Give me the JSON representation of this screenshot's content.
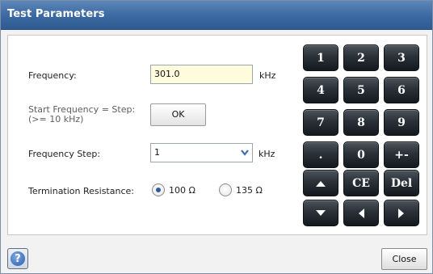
{
  "window": {
    "title": "Test Parameters"
  },
  "form": {
    "frequency_label": "Frequency:",
    "frequency_value": "301.0",
    "frequency_unit": "kHz",
    "start_freq_label_line1": "Start Frequency = Step:",
    "start_freq_label_line2": "(>= 10 kHz)",
    "ok_label": "OK",
    "step_label": "Frequency Step:",
    "step_value": "1",
    "step_unit": "kHz",
    "termination_label": "Termination Resistance:",
    "termination_options": [
      {
        "label": "100 Ω",
        "selected": true
      },
      {
        "label": "135 Ω",
        "selected": false
      }
    ]
  },
  "keypad": {
    "keys": [
      "1",
      "2",
      "3",
      "4",
      "5",
      "6",
      "7",
      "8",
      "9",
      ".",
      "0",
      "+-",
      "",
      "CE",
      "Del",
      "",
      "",
      ""
    ],
    "key_icons": [
      "",
      "",
      "",
      "",
      "",
      "",
      "",
      "",
      "",
      "",
      "",
      "",
      "up-arrow-icon",
      "",
      "",
      "down-arrow-icon",
      "left-arrow-icon",
      "right-arrow-icon"
    ]
  },
  "footer": {
    "help_symbol": "?",
    "close_label": "Close"
  },
  "colors": {
    "title_bar": "#3d6aa3",
    "input_highlight": "#fffbdd",
    "keypad_key": "#2a3138"
  }
}
